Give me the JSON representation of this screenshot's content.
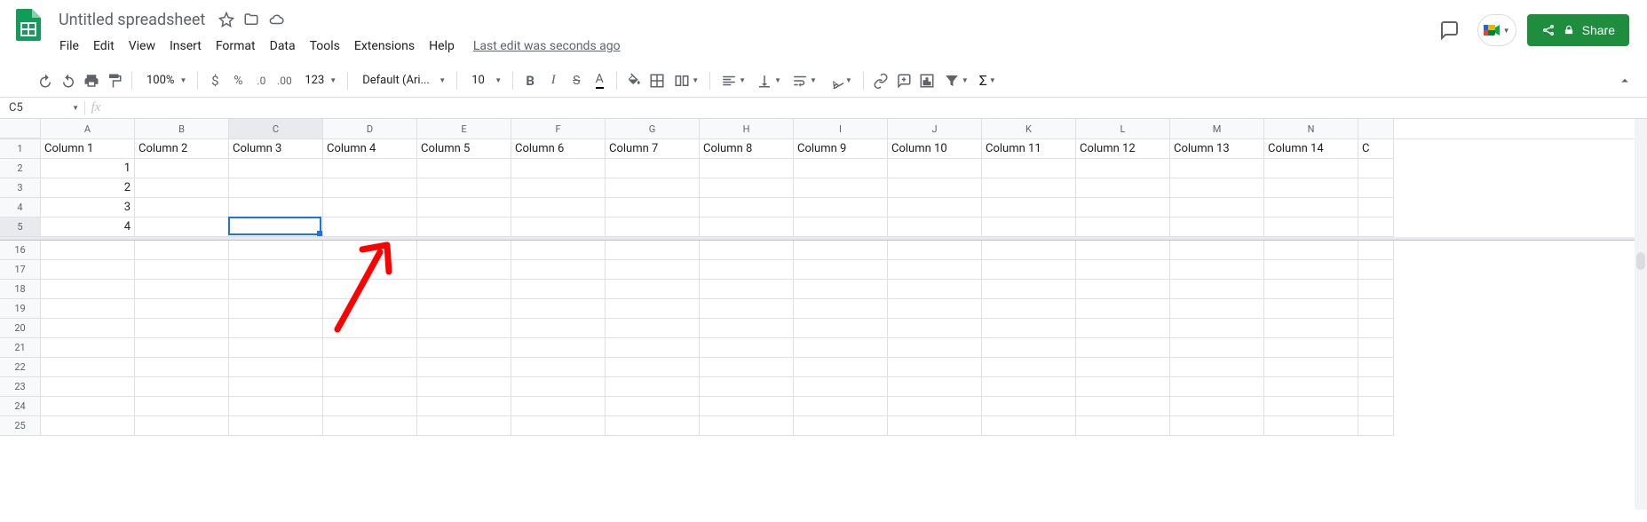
{
  "doc": {
    "title": "Untitled spreadsheet",
    "last_edit": "Last edit was seconds ago"
  },
  "menus": [
    "File",
    "Edit",
    "View",
    "Insert",
    "Format",
    "Data",
    "Tools",
    "Extensions",
    "Help"
  ],
  "share": {
    "label": "Share"
  },
  "toolbar": {
    "zoom": "100%",
    "font": "Default (Ari...",
    "font_size": "10",
    "more_formats": "123"
  },
  "name_box": "C5",
  "columns": [
    "A",
    "B",
    "C",
    "D",
    "E",
    "F",
    "G",
    "H",
    "I",
    "J",
    "K",
    "L",
    "M",
    "N"
  ],
  "row_numbers": [
    1,
    2,
    3,
    4,
    5,
    16,
    17,
    18,
    19,
    20,
    21,
    22,
    23,
    24,
    25
  ],
  "selected_column_index": 2,
  "selected_row_index": 4,
  "cells": {
    "1": [
      "Column 1",
      "Column 2",
      "Column 3",
      "Column 4",
      "Column 5",
      "Column 6",
      "Column 7",
      "Column 8",
      "Column 9",
      "Column 10",
      "Column 11",
      "Column 12",
      "Column 13",
      "Column 14",
      "C"
    ],
    "2": [
      "1"
    ],
    "3": [
      "2"
    ],
    "4": [
      "3"
    ],
    "5": [
      "4"
    ]
  },
  "active_cell": {
    "col": 2,
    "row": 4
  }
}
